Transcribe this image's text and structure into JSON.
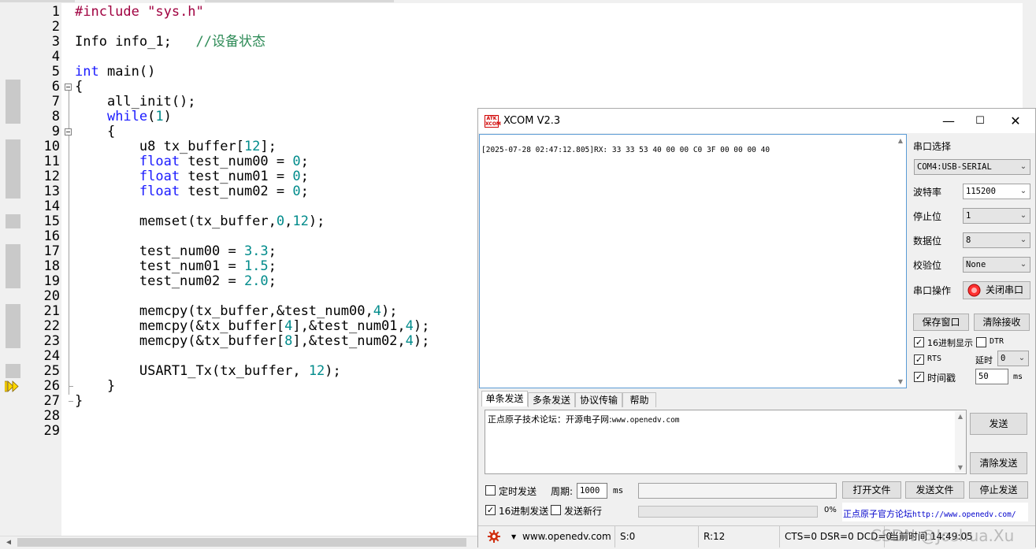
{
  "editor": {
    "lines": [
      {
        "n": "1",
        "segs": [
          {
            "c": "pp",
            "t": "#include "
          },
          {
            "c": "str",
            "t": "\"sys.h\""
          }
        ]
      },
      {
        "n": "2",
        "segs": []
      },
      {
        "n": "3",
        "segs": [
          {
            "c": "",
            "t": "Info info_1;   "
          },
          {
            "c": "cm",
            "t": "//设备状态"
          }
        ]
      },
      {
        "n": "4",
        "segs": []
      },
      {
        "n": "5",
        "segs": [
          {
            "c": "kw",
            "t": "int"
          },
          {
            "c": "",
            "t": " main()"
          }
        ]
      },
      {
        "n": "6",
        "segs": [
          {
            "c": "",
            "t": "{"
          }
        ]
      },
      {
        "n": "7",
        "segs": [
          {
            "c": "",
            "t": "    all_init();"
          }
        ]
      },
      {
        "n": "8",
        "segs": [
          {
            "c": "",
            "t": "    "
          },
          {
            "c": "kw",
            "t": "while"
          },
          {
            "c": "",
            "t": "("
          },
          {
            "c": "num",
            "t": "1"
          },
          {
            "c": "",
            "t": ")"
          }
        ]
      },
      {
        "n": "9",
        "segs": [
          {
            "c": "",
            "t": "    {"
          }
        ]
      },
      {
        "n": "10",
        "segs": [
          {
            "c": "",
            "t": "        u8 tx_buffer["
          },
          {
            "c": "num",
            "t": "12"
          },
          {
            "c": "",
            "t": "];"
          }
        ]
      },
      {
        "n": "11",
        "segs": [
          {
            "c": "",
            "t": "        "
          },
          {
            "c": "kw",
            "t": "float"
          },
          {
            "c": "",
            "t": " test_num00 = "
          },
          {
            "c": "num",
            "t": "0"
          },
          {
            "c": "",
            "t": ";"
          }
        ]
      },
      {
        "n": "12",
        "segs": [
          {
            "c": "",
            "t": "        "
          },
          {
            "c": "kw",
            "t": "float"
          },
          {
            "c": "",
            "t": " test_num01 = "
          },
          {
            "c": "num",
            "t": "0"
          },
          {
            "c": "",
            "t": ";"
          }
        ]
      },
      {
        "n": "13",
        "segs": [
          {
            "c": "",
            "t": "        "
          },
          {
            "c": "kw",
            "t": "float"
          },
          {
            "c": "",
            "t": " test_num02 = "
          },
          {
            "c": "num",
            "t": "0"
          },
          {
            "c": "",
            "t": ";"
          }
        ]
      },
      {
        "n": "14",
        "segs": []
      },
      {
        "n": "15",
        "segs": [
          {
            "c": "",
            "t": "        memset(tx_buffer,"
          },
          {
            "c": "num",
            "t": "0"
          },
          {
            "c": "",
            "t": ","
          },
          {
            "c": "num",
            "t": "12"
          },
          {
            "c": "",
            "t": ");"
          }
        ]
      },
      {
        "n": "16",
        "segs": []
      },
      {
        "n": "17",
        "segs": [
          {
            "c": "",
            "t": "        test_num00 = "
          },
          {
            "c": "num",
            "t": "3.3"
          },
          {
            "c": "",
            "t": ";"
          }
        ]
      },
      {
        "n": "18",
        "segs": [
          {
            "c": "",
            "t": "        test_num01 = "
          },
          {
            "c": "num",
            "t": "1.5"
          },
          {
            "c": "",
            "t": ";"
          }
        ]
      },
      {
        "n": "19",
        "segs": [
          {
            "c": "",
            "t": "        test_num02 = "
          },
          {
            "c": "num",
            "t": "2.0"
          },
          {
            "c": "",
            "t": ";"
          }
        ]
      },
      {
        "n": "20",
        "segs": []
      },
      {
        "n": "21",
        "segs": [
          {
            "c": "",
            "t": "        memcpy(tx_buffer,&test_num00,"
          },
          {
            "c": "num",
            "t": "4"
          },
          {
            "c": "",
            "t": ");"
          }
        ]
      },
      {
        "n": "22",
        "segs": [
          {
            "c": "",
            "t": "        memcpy(&tx_buffer["
          },
          {
            "c": "num",
            "t": "4"
          },
          {
            "c": "",
            "t": "],&test_num01,"
          },
          {
            "c": "num",
            "t": "4"
          },
          {
            "c": "",
            "t": ");"
          }
        ]
      },
      {
        "n": "23",
        "segs": [
          {
            "c": "",
            "t": "        memcpy(&tx_buffer["
          },
          {
            "c": "num",
            "t": "8"
          },
          {
            "c": "",
            "t": "],&test_num02,"
          },
          {
            "c": "num",
            "t": "4"
          },
          {
            "c": "",
            "t": ");"
          }
        ]
      },
      {
        "n": "24",
        "segs": []
      },
      {
        "n": "25",
        "segs": [
          {
            "c": "",
            "t": "        USART1_Tx(tx_buffer, "
          },
          {
            "c": "num",
            "t": "12"
          },
          {
            "c": "",
            "t": ");"
          }
        ]
      },
      {
        "n": "26",
        "segs": [
          {
            "c": "",
            "t": "    }"
          }
        ]
      },
      {
        "n": "27",
        "segs": [
          {
            "c": "",
            "t": "}"
          }
        ]
      },
      {
        "n": "28",
        "segs": []
      },
      {
        "n": "29",
        "segs": []
      }
    ],
    "marked_lines": [
      6,
      7,
      8,
      10,
      11,
      12,
      13,
      15,
      17,
      18,
      19,
      21,
      22,
      23,
      25
    ],
    "current_line": 26
  },
  "xcom": {
    "title": "XCOM V2.3",
    "logo": "ATK XCOM",
    "window_buttons": {
      "minimize": "—",
      "maximize": "☐",
      "close": "✕"
    },
    "receive_text": "[2025-07-28 02:47:12.805]RX: 33 33 53 40 00 00 C0 3F 00 00 00 40",
    "port_label": "串口选择",
    "port_value": "COM4:USB-SERIAL",
    "baud_label": "波特率",
    "baud_value": "115200",
    "stop_label": "停止位",
    "stop_value": "1",
    "data_label": "数据位",
    "data_value": "8",
    "parity_label": "校验位",
    "parity_value": "None",
    "op_label": "串口操作",
    "close_port_label": "关闭串口",
    "save_window_label": "保存窗口",
    "clear_receive_label": "清除接收",
    "hex_display_label": "16进制显示",
    "dtr_label": "DTR",
    "rts_label": "RTS",
    "delay_label": "延时",
    "delay_value": "0",
    "timestamp_label": "时间戳",
    "timestamp_value": "50",
    "ms_unit": "ms",
    "tabs": [
      "单条发送",
      "多条发送",
      "协议传输",
      "帮助"
    ],
    "send_text_cn": "正点原子技术论坛：开源电子网:",
    "send_text_url": "www.openedv.com",
    "send_label": "发送",
    "clear_send_label": "清除发送",
    "timed_send_label": "定时发送",
    "period_label": "周期:",
    "period_value": "1000",
    "period_unit": "ms",
    "open_file_label": "打开文件",
    "send_file_label": "发送文件",
    "stop_send_label": "停止发送",
    "hex_send_label": "16进制发送",
    "send_newline_label": "发送新行",
    "progress_text": "0%",
    "progress": 0,
    "forum_link_cn": "正点原子官方论坛",
    "forum_link_url": "http://www.openedv.com/",
    "status": {
      "url": "www.openedv.com",
      "sent": "S:0",
      "received": "R:12",
      "lines": "CTS=0 DSR=0 DCD=0",
      "time_label": "当前时间",
      "time": "14:49:05"
    }
  },
  "watermark": "CSDN @Joshua.Xu"
}
